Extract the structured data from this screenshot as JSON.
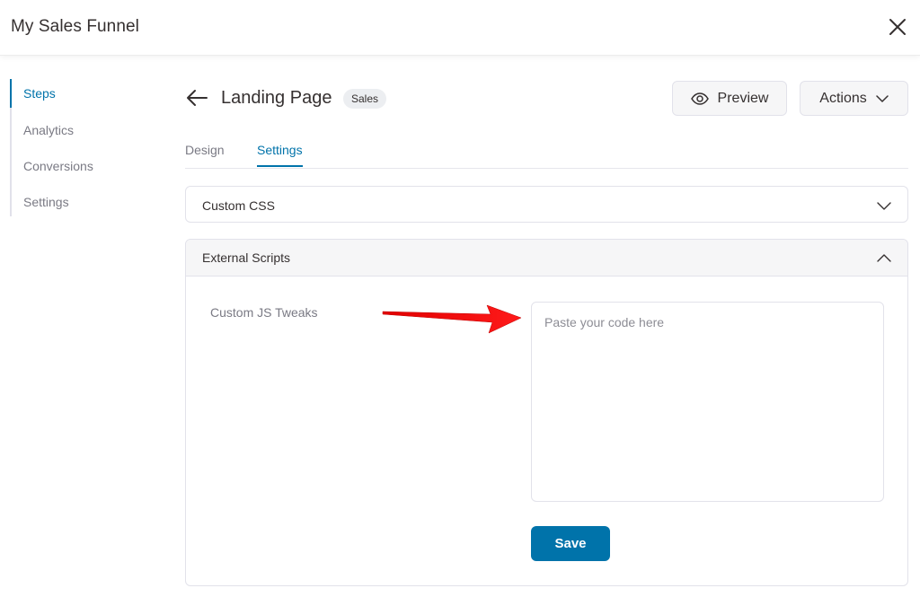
{
  "app": {
    "title": "My Sales Funnel",
    "close_icon": "close-icon"
  },
  "sidebar": {
    "items": [
      {
        "label": "Steps",
        "active": true
      },
      {
        "label": "Analytics",
        "active": false
      },
      {
        "label": "Conversions",
        "active": false
      },
      {
        "label": "Settings",
        "active": false
      }
    ]
  },
  "header": {
    "back_icon": "arrow-left-icon",
    "title": "Landing Page",
    "badge": "Sales",
    "preview_label": "Preview",
    "actions_label": "Actions"
  },
  "tabs": [
    {
      "label": "Design",
      "active": false
    },
    {
      "label": "Settings",
      "active": true
    }
  ],
  "sections": {
    "custom_css": {
      "title": "Custom CSS",
      "expanded": false
    },
    "external_scripts": {
      "title": "External Scripts",
      "expanded": true,
      "field_label": "Custom JS Tweaks",
      "textarea_value": "",
      "textarea_placeholder": "Paste your code here",
      "save_label": "Save"
    }
  },
  "colors": {
    "accent": "#0073aa",
    "annotation_arrow": "#ff0000"
  }
}
